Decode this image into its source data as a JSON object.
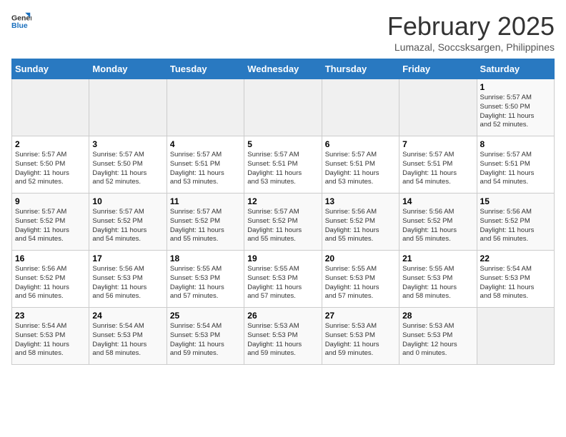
{
  "header": {
    "logo_general": "General",
    "logo_blue": "Blue",
    "month_title": "February 2025",
    "location": "Lumazal, Soccsksargen, Philippines"
  },
  "weekdays": [
    "Sunday",
    "Monday",
    "Tuesday",
    "Wednesday",
    "Thursday",
    "Friday",
    "Saturday"
  ],
  "weeks": [
    [
      {
        "day": "",
        "info": ""
      },
      {
        "day": "",
        "info": ""
      },
      {
        "day": "",
        "info": ""
      },
      {
        "day": "",
        "info": ""
      },
      {
        "day": "",
        "info": ""
      },
      {
        "day": "",
        "info": ""
      },
      {
        "day": "1",
        "info": "Sunrise: 5:57 AM\nSunset: 5:50 PM\nDaylight: 11 hours\nand 52 minutes."
      }
    ],
    [
      {
        "day": "2",
        "info": "Sunrise: 5:57 AM\nSunset: 5:50 PM\nDaylight: 11 hours\nand 52 minutes."
      },
      {
        "day": "3",
        "info": "Sunrise: 5:57 AM\nSunset: 5:50 PM\nDaylight: 11 hours\nand 52 minutes."
      },
      {
        "day": "4",
        "info": "Sunrise: 5:57 AM\nSunset: 5:51 PM\nDaylight: 11 hours\nand 53 minutes."
      },
      {
        "day": "5",
        "info": "Sunrise: 5:57 AM\nSunset: 5:51 PM\nDaylight: 11 hours\nand 53 minutes."
      },
      {
        "day": "6",
        "info": "Sunrise: 5:57 AM\nSunset: 5:51 PM\nDaylight: 11 hours\nand 53 minutes."
      },
      {
        "day": "7",
        "info": "Sunrise: 5:57 AM\nSunset: 5:51 PM\nDaylight: 11 hours\nand 54 minutes."
      },
      {
        "day": "8",
        "info": "Sunrise: 5:57 AM\nSunset: 5:51 PM\nDaylight: 11 hours\nand 54 minutes."
      }
    ],
    [
      {
        "day": "9",
        "info": "Sunrise: 5:57 AM\nSunset: 5:52 PM\nDaylight: 11 hours\nand 54 minutes."
      },
      {
        "day": "10",
        "info": "Sunrise: 5:57 AM\nSunset: 5:52 PM\nDaylight: 11 hours\nand 54 minutes."
      },
      {
        "day": "11",
        "info": "Sunrise: 5:57 AM\nSunset: 5:52 PM\nDaylight: 11 hours\nand 55 minutes."
      },
      {
        "day": "12",
        "info": "Sunrise: 5:57 AM\nSunset: 5:52 PM\nDaylight: 11 hours\nand 55 minutes."
      },
      {
        "day": "13",
        "info": "Sunrise: 5:56 AM\nSunset: 5:52 PM\nDaylight: 11 hours\nand 55 minutes."
      },
      {
        "day": "14",
        "info": "Sunrise: 5:56 AM\nSunset: 5:52 PM\nDaylight: 11 hours\nand 55 minutes."
      },
      {
        "day": "15",
        "info": "Sunrise: 5:56 AM\nSunset: 5:52 PM\nDaylight: 11 hours\nand 56 minutes."
      }
    ],
    [
      {
        "day": "16",
        "info": "Sunrise: 5:56 AM\nSunset: 5:52 PM\nDaylight: 11 hours\nand 56 minutes."
      },
      {
        "day": "17",
        "info": "Sunrise: 5:56 AM\nSunset: 5:53 PM\nDaylight: 11 hours\nand 56 minutes."
      },
      {
        "day": "18",
        "info": "Sunrise: 5:55 AM\nSunset: 5:53 PM\nDaylight: 11 hours\nand 57 minutes."
      },
      {
        "day": "19",
        "info": "Sunrise: 5:55 AM\nSunset: 5:53 PM\nDaylight: 11 hours\nand 57 minutes."
      },
      {
        "day": "20",
        "info": "Sunrise: 5:55 AM\nSunset: 5:53 PM\nDaylight: 11 hours\nand 57 minutes."
      },
      {
        "day": "21",
        "info": "Sunrise: 5:55 AM\nSunset: 5:53 PM\nDaylight: 11 hours\nand 58 minutes."
      },
      {
        "day": "22",
        "info": "Sunrise: 5:54 AM\nSunset: 5:53 PM\nDaylight: 11 hours\nand 58 minutes."
      }
    ],
    [
      {
        "day": "23",
        "info": "Sunrise: 5:54 AM\nSunset: 5:53 PM\nDaylight: 11 hours\nand 58 minutes."
      },
      {
        "day": "24",
        "info": "Sunrise: 5:54 AM\nSunset: 5:53 PM\nDaylight: 11 hours\nand 58 minutes."
      },
      {
        "day": "25",
        "info": "Sunrise: 5:54 AM\nSunset: 5:53 PM\nDaylight: 11 hours\nand 59 minutes."
      },
      {
        "day": "26",
        "info": "Sunrise: 5:53 AM\nSunset: 5:53 PM\nDaylight: 11 hours\nand 59 minutes."
      },
      {
        "day": "27",
        "info": "Sunrise: 5:53 AM\nSunset: 5:53 PM\nDaylight: 11 hours\nand 59 minutes."
      },
      {
        "day": "28",
        "info": "Sunrise: 5:53 AM\nSunset: 5:53 PM\nDaylight: 12 hours\nand 0 minutes."
      },
      {
        "day": "",
        "info": ""
      }
    ]
  ]
}
